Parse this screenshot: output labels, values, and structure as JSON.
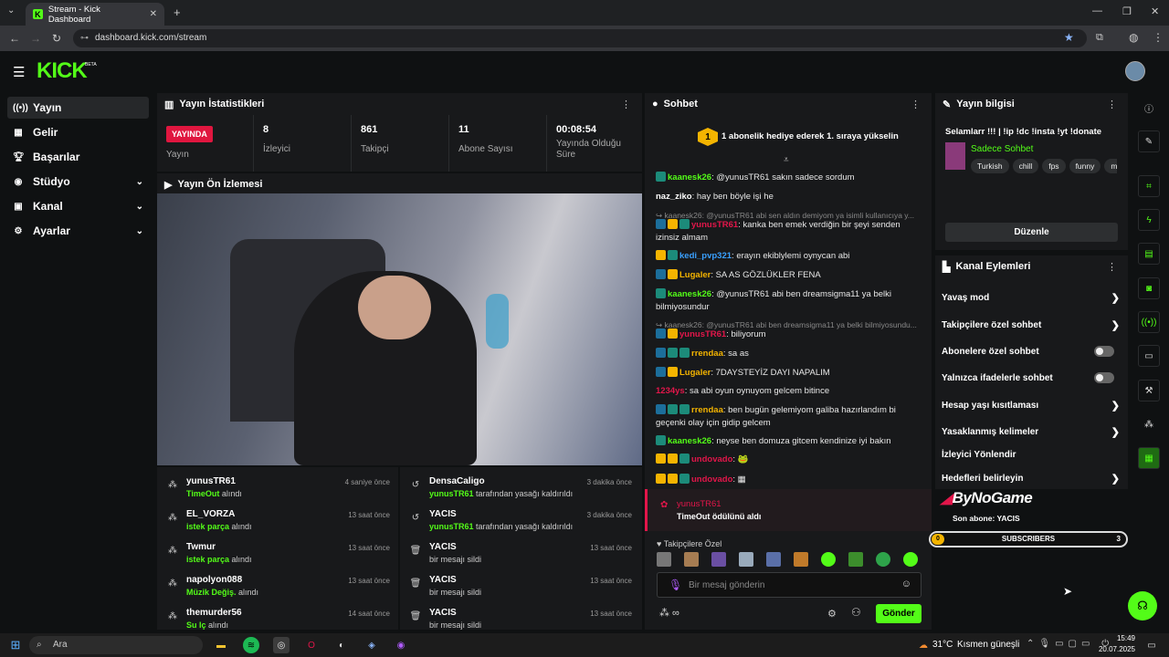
{
  "browser": {
    "tab_title": "Stream - Kick Dashboard",
    "url": "dashboard.kick.com/stream"
  },
  "brand": {
    "logo": "KICK",
    "logo_badge": "BETA",
    "accent": "#53fc18"
  },
  "sidebar": {
    "items": [
      {
        "label": "Yayın",
        "icon": "broadcast-icon"
      },
      {
        "label": "Gelir",
        "icon": "revenue-icon"
      },
      {
        "label": "Başarılar",
        "icon": "trophy-icon"
      },
      {
        "label": "Stüdyo",
        "icon": "studio-icon"
      },
      {
        "label": "Kanal",
        "icon": "channel-icon"
      },
      {
        "label": "Ayarlar",
        "icon": "gear-icon"
      }
    ]
  },
  "stats": {
    "title": "Yayın İstatistikleri",
    "live_badge": "YAYINDA",
    "live_label": "Yayın",
    "viewers_value": "8",
    "viewers_label": "İzleyici",
    "followers_value": "861",
    "followers_label": "Takipçi",
    "subs_value": "11",
    "subs_label": "Abone Sayısı",
    "duration_value": "00:08:54",
    "duration_label": "Yayında Olduğu Süre"
  },
  "preview": {
    "title": "Yayın Ön İzlemesi"
  },
  "events_left": [
    {
      "name": "yunusTR61",
      "hl": "TimeOut",
      "rest": " alındı",
      "time": "4 saniye önce"
    },
    {
      "name": "EL_VORZA",
      "hl": "istek parça",
      "rest": " alındı",
      "time": "13 saat önce"
    },
    {
      "name": "Twmur",
      "hl": "istek parça",
      "rest": " alındı",
      "time": "13 saat önce"
    },
    {
      "name": "napolyon088",
      "hl": "Müzik Değiş.",
      "rest": " alındı",
      "time": "13 saat önce"
    },
    {
      "name": "themurder56",
      "hl": "Su Iç",
      "rest": " alındı",
      "time": "14 saat önce"
    }
  ],
  "events_right": [
    {
      "name": "DensaCaligo",
      "hl": "yunusTR61",
      "rest": " tarafından yasağı kaldırıldı",
      "time": "3 dakika önce"
    },
    {
      "name": "YACIS",
      "hl": "yunusTR61",
      "rest": " tarafından yasağı kaldırıldı",
      "time": "3 dakika önce"
    },
    {
      "name": "YACIS",
      "hl": "",
      "rest": "bir mesajı sildi",
      "time": "13 saat önce"
    },
    {
      "name": "YACIS",
      "hl": "",
      "rest": "bir mesajı sildi",
      "time": "13 saat önce"
    },
    {
      "name": "YACIS",
      "hl": "",
      "rest": "bir mesajı sildi",
      "time": "13 saat önce"
    }
  ],
  "chat": {
    "title": "Sohbet",
    "pinned": "1 abonelik hediye ederek 1. sıraya yükselin",
    "pinned_badge": "1",
    "messages": [
      {
        "user": "kaanesk26",
        "color": "#53fc18",
        "text": "@yunusTR61 sakın sadece sordum"
      },
      {
        "user": "naz_ziko",
        "color": "#ffffff",
        "text": "hay ben böyle işi he"
      },
      {
        "reply": "kaanesk26: @yunusTR61 abi sen aldın demiyom ya isimli kullanıcıya y..."
      },
      {
        "user": "yunusTR61",
        "color": "#e2164a",
        "text": "kanka ben emek verdiğin bir şeyi senden izinsiz almam"
      },
      {
        "user": "kedi_pvp321",
        "color": "#3aa0ff",
        "text": "erayın ekiblylemi oynycan abi"
      },
      {
        "user": "Lugaler",
        "color": "#f4b400",
        "text": "SA AS GÖZLÜKLER FENA"
      },
      {
        "user": "kaanesk26",
        "color": "#53fc18",
        "text": "@yunusTR61 abi ben dreamsigma11 ya belki bilmiyosundur"
      },
      {
        "reply": "kaanesk26: @yunusTR61 abi ben dreamsigma11 ya belki bilmiyosundu..."
      },
      {
        "user": "yunusTR61",
        "color": "#e2164a",
        "text": "biliyorum"
      },
      {
        "user": "rrendaa",
        "color": "#f4b400",
        "text": "sa as"
      },
      {
        "user": "Lugaler",
        "color": "#f4b400",
        "text": "7DAYSTEYİZ DAYI NAPALIM"
      },
      {
        "user": "1234ys",
        "color": "#e2164a",
        "text": "sa abi oyun oynuyom gelcem bitince"
      },
      {
        "user": "rrendaa",
        "color": "#f4b400",
        "text": "ben bugün gelemiyom galiba hazırlandım bi geçenki olay için gidip gelcem"
      },
      {
        "user": "kaanesk26",
        "color": "#53fc18",
        "text": "neyse ben domuza gitcem kendinize iyi bakın"
      },
      {
        "user": "undovado",
        "color": "#e2164a",
        "text": "🐸"
      },
      {
        "user": "undovado",
        "color": "#e2164a",
        "text": "▦"
      }
    ],
    "alert_user": "yunusTR61",
    "alert_text": "TimeOut ödülünü aldı",
    "followers_only": "Takipçilere Özel",
    "placeholder": "Bir mesaj gönderin",
    "send": "Gönder"
  },
  "info": {
    "title": "Yayın bilgisi",
    "stream_title": "Selamlarr !!! | !ip !dc !insta !yt !donate",
    "category": "Sadece Sohbet",
    "tags": [
      "Turkish",
      "chill",
      "fps",
      "funny",
      "min"
    ],
    "edit": "Düzenle"
  },
  "actions": {
    "title": "Kanal Eylemleri",
    "items": [
      {
        "label": "Yavaş mod",
        "ctrl": "chev"
      },
      {
        "label": "Takipçilere özel sohbet",
        "ctrl": "chev"
      },
      {
        "label": "Abonelere özel sohbet",
        "ctrl": "switch"
      },
      {
        "label": "Yalnızca ifadelerle sohbet",
        "ctrl": "switch"
      },
      {
        "label": "Hesap yaşı kısıtlaması",
        "ctrl": "chev"
      },
      {
        "label": "Yasaklanmış kelimeler",
        "ctrl": "chev"
      },
      {
        "label": "İzleyici Yönlendir",
        "ctrl": "none"
      },
      {
        "label": "Hedefleri belirleyin",
        "ctrl": "chev"
      }
    ]
  },
  "overlay": {
    "brand": "ByNoGame",
    "last_sub": "Son abone: YACIS",
    "bar_left": "0",
    "bar_label": "SUBSCRIBERS",
    "bar_right": "3"
  },
  "taskbar": {
    "search": "Ara",
    "weather": "31°C",
    "weather_text": "Kısmen güneşli",
    "time": "15:49",
    "date": "20.07.2025"
  }
}
